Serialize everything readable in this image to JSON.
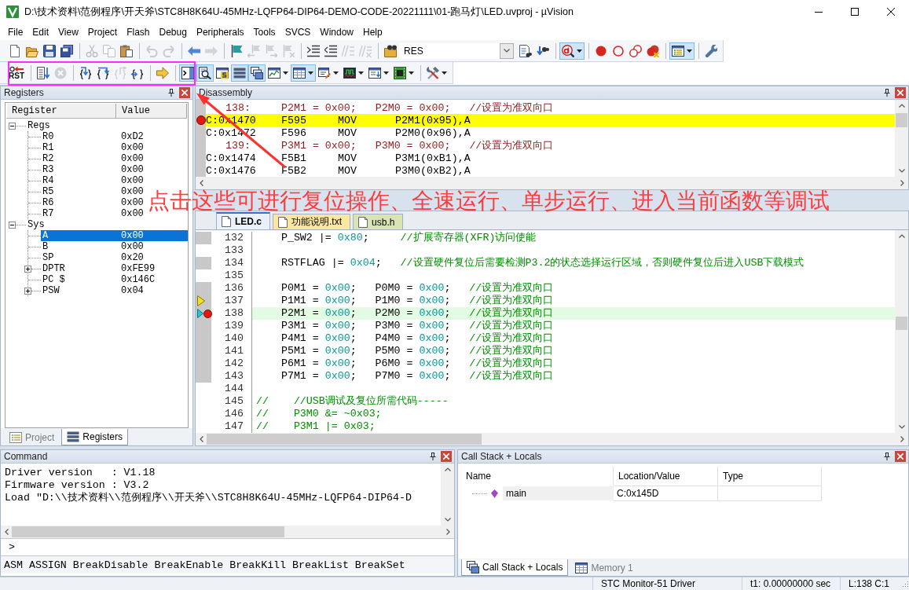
{
  "window": {
    "title": "D:\\技术资料\\范例程序\\开天斧\\STC8H8K64U-45MHz-LQFP64-DIP64-DEMO-CODE-20221111\\01-跑马灯\\LED.uvproj - µVision"
  },
  "menu": [
    "File",
    "Edit",
    "View",
    "Project",
    "Flash",
    "Debug",
    "Peripherals",
    "Tools",
    "SVCS",
    "Window",
    "Help"
  ],
  "toolbar_1": [
    {
      "kind": "button",
      "on": false,
      "disabled": false
    },
    {
      "kind": "button",
      "on": false,
      "disabled": false
    },
    {
      "kind": "button",
      "on": false,
      "disabled": false
    },
    {
      "kind": "button",
      "on": false,
      "disabled": false
    },
    {
      "kind": "separator"
    },
    {
      "kind": "button",
      "on": false,
      "disabled": true
    },
    {
      "kind": "button",
      "on": false,
      "disabled": true
    },
    {
      "kind": "button",
      "on": false,
      "disabled": false
    },
    {
      "kind": "separator"
    },
    {
      "kind": "button",
      "on": false,
      "disabled": true
    },
    {
      "kind": "button",
      "on": false,
      "disabled": true
    },
    {
      "kind": "separator"
    },
    {
      "kind": "button",
      "on": false,
      "disabled": false
    },
    {
      "kind": "button",
      "on": false,
      "disabled": true
    },
    {
      "kind": "separator"
    },
    {
      "kind": "button",
      "on": false,
      "disabled": false
    },
    {
      "kind": "button",
      "on": false,
      "disabled": true
    },
    {
      "kind": "button",
      "on": false,
      "disabled": true
    },
    {
      "kind": "button",
      "on": false,
      "disabled": true
    },
    {
      "kind": "separator"
    },
    {
      "kind": "button",
      "on": false,
      "disabled": false
    },
    {
      "kind": "button",
      "on": false,
      "disabled": false
    },
    {
      "kind": "button",
      "on": false,
      "disabled": true
    },
    {
      "kind": "button",
      "on": false,
      "disabled": true
    },
    {
      "kind": "separator"
    },
    {
      "kind": "button",
      "on": false,
      "disabled": false
    },
    {
      "kind": "combo",
      "value": "RES"
    },
    {
      "kind": "button",
      "on": false,
      "disabled": false
    },
    {
      "kind": "button",
      "on": false,
      "disabled": false
    },
    {
      "kind": "separator"
    },
    {
      "kind": "split",
      "on": true,
      "disabled": false
    },
    {
      "kind": "separator"
    },
    {
      "kind": "button",
      "on": false,
      "disabled": false
    },
    {
      "kind": "button",
      "on": false,
      "disabled": false
    },
    {
      "kind": "button",
      "on": false,
      "disabled": false
    },
    {
      "kind": "button",
      "on": false,
      "disabled": false
    },
    {
      "kind": "separator"
    },
    {
      "kind": "split",
      "on": true,
      "disabled": false
    },
    {
      "kind": "separator"
    },
    {
      "kind": "button",
      "on": false,
      "disabled": false
    }
  ],
  "toolbar_2": [
    {
      "kind": "label_button",
      "label": "RST",
      "on": false,
      "disabled": false
    },
    {
      "kind": "separator"
    },
    {
      "kind": "button",
      "on": false,
      "disabled": false
    },
    {
      "kind": "button",
      "on": false,
      "disabled": true
    },
    {
      "kind": "separator"
    },
    {
      "kind": "button",
      "on": false,
      "disabled": false
    },
    {
      "kind": "button",
      "on": false,
      "disabled": false
    },
    {
      "kind": "button",
      "on": false,
      "disabled": true
    },
    {
      "kind": "button",
      "on": false,
      "disabled": false
    },
    {
      "kind": "separator"
    },
    {
      "kind": "button",
      "on": false,
      "disabled": false
    },
    {
      "kind": "separator"
    },
    {
      "kind": "button",
      "on": true,
      "disabled": false
    },
    {
      "kind": "button",
      "on": true,
      "disabled": false
    },
    {
      "kind": "button",
      "on": false,
      "disabled": false
    },
    {
      "kind": "button",
      "on": true,
      "disabled": false
    },
    {
      "kind": "button",
      "on": true,
      "disabled": false
    },
    {
      "kind": "split",
      "on": false,
      "disabled": false
    },
    {
      "kind": "split",
      "on": true,
      "disabled": false
    },
    {
      "kind": "split",
      "on": false,
      "disabled": false
    },
    {
      "kind": "split",
      "on": false,
      "disabled": false
    },
    {
      "kind": "split",
      "on": false,
      "disabled": false
    },
    {
      "kind": "split",
      "on": false,
      "disabled": false
    },
    {
      "kind": "separator"
    },
    {
      "kind": "split",
      "on": false,
      "disabled": false
    }
  ],
  "registers_panel": {
    "title": "Registers",
    "columns": [
      "Register",
      "Value"
    ],
    "groups": [
      {
        "name": "Regs",
        "expanded": true,
        "children": [
          {
            "name": "R0",
            "value": "0xD2",
            "selected": false
          },
          {
            "name": "R1",
            "value": "0x00",
            "selected": false
          },
          {
            "name": "R2",
            "value": "0x00",
            "selected": false
          },
          {
            "name": "R3",
            "value": "0x00",
            "selected": false
          },
          {
            "name": "R4",
            "value": "0x00",
            "selected": false
          },
          {
            "name": "R5",
            "value": "0x00",
            "selected": false
          },
          {
            "name": "R6",
            "value": "0x00",
            "selected": false
          },
          {
            "name": "R7",
            "value": "0x00",
            "selected": false
          }
        ]
      },
      {
        "name": "Sys",
        "expanded": true,
        "children": [
          {
            "name": "A",
            "value": "0x00",
            "selected": true
          },
          {
            "name": "B",
            "value": "0x00",
            "selected": false
          },
          {
            "name": "SP",
            "value": "0x20",
            "selected": false
          },
          {
            "name": "DPTR",
            "value": "0xFE99",
            "selected": false,
            "expanded": false
          },
          {
            "name": "PC $",
            "value": "0x146C",
            "selected": false
          },
          {
            "name": "PSW",
            "value": "0x04",
            "selected": false,
            "expanded": false
          }
        ]
      }
    ],
    "tabs": [
      {
        "label": "Project",
        "selected": false
      },
      {
        "label": "Registers",
        "selected": true
      }
    ]
  },
  "disassembly": {
    "title": "Disassembly",
    "lines": [
      {
        "kind": "source",
        "number": "138:",
        "code": "P2M1 = 0x00;   P2M0 = 0x00;   //设置为准双向口",
        "current": false,
        "breakpoint": false
      },
      {
        "kind": "asm",
        "address": "C:0x1470",
        "opcode": "F595",
        "mnemonic": "MOV",
        "operands": "P2M1(0x95),A",
        "current": true,
        "breakpoint": true
      },
      {
        "kind": "asm",
        "address": "C:0x1472",
        "opcode": "F596",
        "mnemonic": "MOV",
        "operands": "P2M0(0x96),A",
        "current": false,
        "breakpoint": false
      },
      {
        "kind": "source",
        "number": "139:",
        "code": "P3M1 = 0x00;   P3M0 = 0x00;   //设置为准双向口",
        "current": false,
        "breakpoint": false
      },
      {
        "kind": "asm",
        "address": "C:0x1474",
        "opcode": "F5B1",
        "mnemonic": "MOV",
        "operands": "P3M1(0xB1),A",
        "current": false,
        "breakpoint": false
      },
      {
        "kind": "asm",
        "address": "C:0x1476",
        "opcode": "F5B2",
        "mnemonic": "MOV",
        "operands": "P3M0(0xB2),A",
        "current": false,
        "breakpoint": false
      }
    ]
  },
  "editor": {
    "tabs": [
      {
        "label": "LED.c",
        "selected": true,
        "color": "#eaf1fb"
      },
      {
        "label": "功能说明.txt",
        "selected": false,
        "color": "#fbe7a1"
      },
      {
        "label": "usb.h",
        "selected": false,
        "color": "#d9e4b4"
      }
    ],
    "lines": [
      {
        "number": "132",
        "executable": true,
        "current_marker": false,
        "cursor_marker": false,
        "breakpoint": false,
        "highlighted": false,
        "segments": [
          {
            "text": "    P_SW2 |= ",
            "kind": "plain"
          },
          {
            "text": "0x80",
            "kind": "number"
          },
          {
            "text": ";     ",
            "kind": "plain"
          },
          {
            "text": "//扩展寄存器(XFR)访问使能",
            "kind": "comment"
          }
        ]
      },
      {
        "number": "133",
        "executable": false,
        "current_marker": false,
        "cursor_marker": false,
        "breakpoint": false,
        "highlighted": false
      },
      {
        "number": "134",
        "executable": true,
        "current_marker": false,
        "cursor_marker": false,
        "breakpoint": false,
        "highlighted": false,
        "segments": [
          {
            "text": "    RSTFLAG |= ",
            "kind": "plain"
          },
          {
            "text": "0x04",
            "kind": "number"
          },
          {
            "text": ";   ",
            "kind": "plain"
          },
          {
            "text": "//设置硬件复位后需要检测P3.2的状态选择运行区域，否则硬件复位后进入USB下载模式",
            "kind": "comment"
          }
        ]
      },
      {
        "number": "135",
        "executable": false,
        "current_marker": false,
        "cursor_marker": false,
        "breakpoint": false,
        "highlighted": false
      },
      {
        "number": "136",
        "executable": true,
        "current_marker": false,
        "cursor_marker": false,
        "breakpoint": false,
        "highlighted": false,
        "segments": [
          {
            "text": "    P0M1 = ",
            "kind": "plain"
          },
          {
            "text": "0x00",
            "kind": "number"
          },
          {
            "text": ";   P0M0 = ",
            "kind": "plain"
          },
          {
            "text": "0x00",
            "kind": "number"
          },
          {
            "text": ";   ",
            "kind": "plain"
          },
          {
            "text": "//设置为准双向口",
            "kind": "comment"
          }
        ]
      },
      {
        "number": "137",
        "executable": true,
        "current_marker": true,
        "cursor_marker": false,
        "breakpoint": false,
        "highlighted": false,
        "segments": [
          {
            "text": "    P1M1 = ",
            "kind": "plain"
          },
          {
            "text": "0x00",
            "kind": "number"
          },
          {
            "text": ";   P1M0 = ",
            "kind": "plain"
          },
          {
            "text": "0x00",
            "kind": "number"
          },
          {
            "text": ";   ",
            "kind": "plain"
          },
          {
            "text": "//设置为准双向口",
            "kind": "comment"
          }
        ]
      },
      {
        "number": "138",
        "executable": true,
        "current_marker": false,
        "cursor_marker": true,
        "breakpoint": true,
        "highlighted": true,
        "segments": [
          {
            "text": "    P2M1 = ",
            "kind": "plain"
          },
          {
            "text": "0x00",
            "kind": "number"
          },
          {
            "text": ";   P2M0 = ",
            "kind": "plain"
          },
          {
            "text": "0x00",
            "kind": "number"
          },
          {
            "text": ";   ",
            "kind": "plain"
          },
          {
            "text": "//设置为准双向口",
            "kind": "comment"
          }
        ]
      },
      {
        "number": "139",
        "executable": true,
        "current_marker": false,
        "cursor_marker": false,
        "breakpoint": false,
        "highlighted": false,
        "segments": [
          {
            "text": "    P3M1 = ",
            "kind": "plain"
          },
          {
            "text": "0x00",
            "kind": "number"
          },
          {
            "text": ";   P3M0 = ",
            "kind": "plain"
          },
          {
            "text": "0x00",
            "kind": "number"
          },
          {
            "text": ";   ",
            "kind": "plain"
          },
          {
            "text": "//设置为准双向口",
            "kind": "comment"
          }
        ]
      },
      {
        "number": "140",
        "executable": true,
        "current_marker": false,
        "cursor_marker": false,
        "breakpoint": false,
        "highlighted": false,
        "segments": [
          {
            "text": "    P4M1 = ",
            "kind": "plain"
          },
          {
            "text": "0x00",
            "kind": "number"
          },
          {
            "text": ";   P4M0 = ",
            "kind": "plain"
          },
          {
            "text": "0x00",
            "kind": "number"
          },
          {
            "text": ";   ",
            "kind": "plain"
          },
          {
            "text": "//设置为准双向口",
            "kind": "comment"
          }
        ]
      },
      {
        "number": "141",
        "executable": true,
        "current_marker": false,
        "cursor_marker": false,
        "breakpoint": false,
        "highlighted": false,
        "segments": [
          {
            "text": "    P5M1 = ",
            "kind": "plain"
          },
          {
            "text": "0x00",
            "kind": "number"
          },
          {
            "text": ";   P5M0 = ",
            "kind": "plain"
          },
          {
            "text": "0x00",
            "kind": "number"
          },
          {
            "text": ";   ",
            "kind": "plain"
          },
          {
            "text": "//设置为准双向口",
            "kind": "comment"
          }
        ]
      },
      {
        "number": "142",
        "executable": true,
        "current_marker": false,
        "cursor_marker": false,
        "breakpoint": false,
        "highlighted": false,
        "segments": [
          {
            "text": "    P6M1 = ",
            "kind": "plain"
          },
          {
            "text": "0x00",
            "kind": "number"
          },
          {
            "text": ";   P6M0 = ",
            "kind": "plain"
          },
          {
            "text": "0x00",
            "kind": "number"
          },
          {
            "text": ";   ",
            "kind": "plain"
          },
          {
            "text": "//设置为准双向口",
            "kind": "comment"
          }
        ]
      },
      {
        "number": "143",
        "executable": true,
        "current_marker": false,
        "cursor_marker": false,
        "breakpoint": false,
        "highlighted": false,
        "segments": [
          {
            "text": "    P7M1 = ",
            "kind": "plain"
          },
          {
            "text": "0x00",
            "kind": "number"
          },
          {
            "text": ";   P7M0 = ",
            "kind": "plain"
          },
          {
            "text": "0x00",
            "kind": "number"
          },
          {
            "text": ";   ",
            "kind": "plain"
          },
          {
            "text": "//设置为准双向口",
            "kind": "comment"
          }
        ]
      },
      {
        "number": "144",
        "executable": false,
        "current_marker": false,
        "cursor_marker": false,
        "breakpoint": false,
        "highlighted": false
      },
      {
        "number": "145",
        "executable": false,
        "current_marker": false,
        "cursor_marker": false,
        "breakpoint": false,
        "highlighted": false,
        "segments": [
          {
            "text": "//    //USB调试及复位所需代码-----",
            "kind": "comment"
          }
        ]
      },
      {
        "number": "146",
        "executable": false,
        "current_marker": false,
        "cursor_marker": false,
        "breakpoint": false,
        "highlighted": false,
        "segments": [
          {
            "text": "//    P3M0 &= ~0x03;",
            "kind": "comment"
          }
        ]
      },
      {
        "number": "147",
        "executable": false,
        "current_marker": false,
        "cursor_marker": false,
        "breakpoint": false,
        "highlighted": false,
        "segments": [
          {
            "text": "//    P3M1 |= 0x03;",
            "kind": "comment"
          }
        ]
      }
    ]
  },
  "command": {
    "title": "Command",
    "output": [
      "Driver version   : V1.18",
      "Firmware version : V3.2",
      "Load \"D:\\\\技术资料\\\\范例程序\\\\开天斧\\\\STC8H8K64U-45MHz-LQFP64-DIP64-D"
    ],
    "prompt": ">",
    "hint": "ASM ASSIGN BreakDisable BreakEnable BreakKill BreakList BreakSet"
  },
  "call_stack": {
    "title": "Call Stack + Locals",
    "columns": [
      "Name",
      "Location/Value",
      "Type"
    ],
    "rows": [
      {
        "name": "main",
        "location": "C:0x145D"
      }
    ],
    "tabs": [
      {
        "label": "Call Stack + Locals",
        "selected": true
      },
      {
        "label": "Memory 1",
        "selected": false
      }
    ]
  },
  "status_bar": [
    "STC Monitor-51 Driver",
    "t1: 0.00000000 sec",
    "L:138 C:1"
  ],
  "annotation": {
    "text": "点击这些可进行复位操作、全速运行、单步运行、进入当前函数等调试"
  }
}
